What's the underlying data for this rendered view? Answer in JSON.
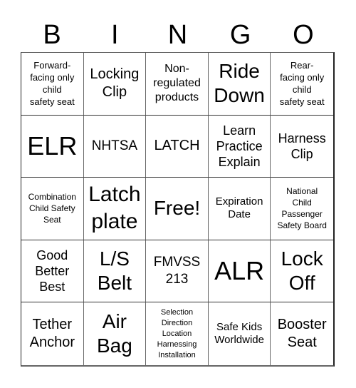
{
  "header": {
    "letters": [
      "B",
      "I",
      "N",
      "G",
      "O"
    ]
  },
  "cells": [
    {
      "text": "Forward-\nfacing only\nchild\nsafety seat",
      "size": "s13"
    },
    {
      "text": "Locking\nClip",
      "size": "s20"
    },
    {
      "text": "Non-\nregulated\nproducts",
      "size": "s16"
    },
    {
      "text": "Ride\nDown",
      "size": "s28"
    },
    {
      "text": "Rear-\nfacing only\nchild\nsafety seat",
      "size": "s13"
    },
    {
      "text": "ELR",
      "size": "s36"
    },
    {
      "text": "NHTSA",
      "size": "s19"
    },
    {
      "text": "LATCH",
      "size": "s20"
    },
    {
      "text": "Learn\nPractice\nExplain",
      "size": "s18"
    },
    {
      "text": "Harness\nClip",
      "size": "s18"
    },
    {
      "text": "Combination\nChild Safety\nSeat",
      "size": "s12"
    },
    {
      "text": "Latch\nplate",
      "size": "s30"
    },
    {
      "text": "Free!",
      "size": "s28"
    },
    {
      "text": "Expiration\nDate",
      "size": "s15"
    },
    {
      "text": "National\nChild\nPassenger\nSafety Board",
      "size": "s12"
    },
    {
      "text": "Good\nBetter\nBest",
      "size": "s18"
    },
    {
      "text": "L/S\nBelt",
      "size": "s28"
    },
    {
      "text": "FMVSS\n213",
      "size": "s19"
    },
    {
      "text": "ALR",
      "size": "s36"
    },
    {
      "text": "Lock\nOff",
      "size": "s28"
    },
    {
      "text": "Tether\nAnchor",
      "size": "s20"
    },
    {
      "text": "Air\nBag",
      "size": "s28"
    },
    {
      "text": "Selection\nDirection\nLocation\nHarnessing\nInstallation",
      "size": "s11"
    },
    {
      "text": "Safe Kids\nWorldwide",
      "size": "s15"
    },
    {
      "text": "Booster\nSeat",
      "size": "s20"
    }
  ]
}
